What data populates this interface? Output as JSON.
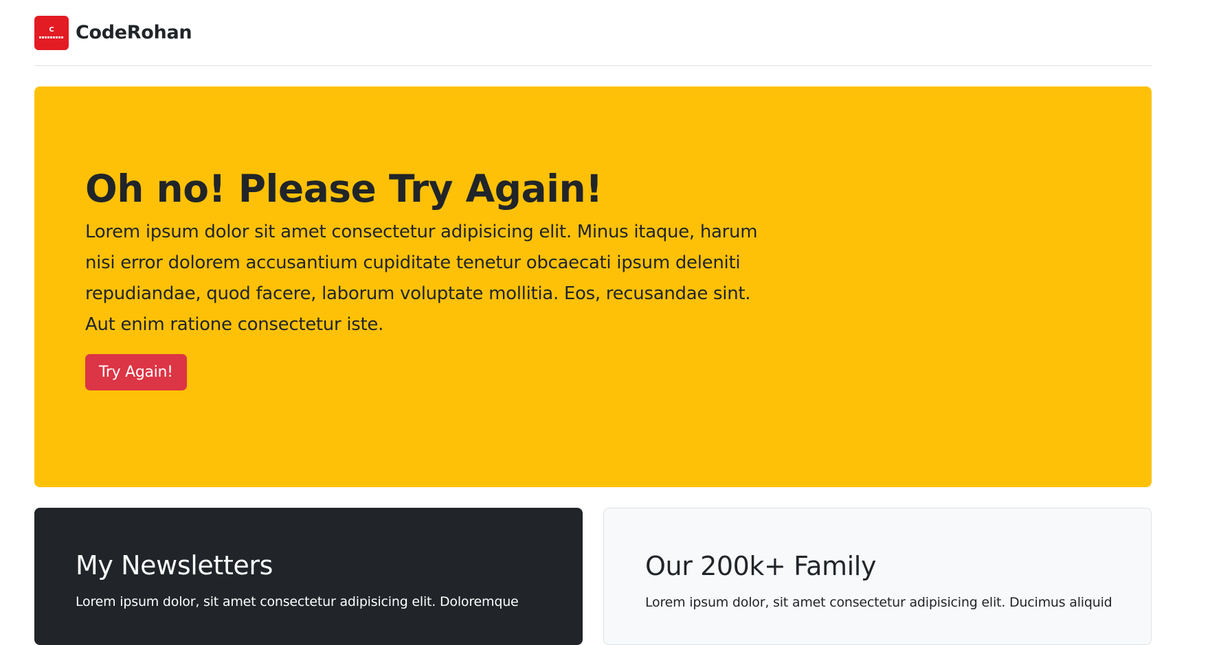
{
  "header": {
    "logo_letter": "C",
    "brand": "CodeRohan"
  },
  "hero": {
    "title": "Oh no! Please Try Again!",
    "body": "Lorem ipsum dolor sit amet consectetur adipisicing elit. Minus itaque, harum nisi error dolorem accusantium cupiditate tenetur obcaecati ipsum deleniti repudiandae, quod facere, laborum voluptate mollitia. Eos, recusandae sint. Aut enim ratione consectetur iste.",
    "button_label": "Try Again!"
  },
  "cards": [
    {
      "title": "My Newsletters",
      "text": "Lorem ipsum dolor, sit amet consectetur adipisicing elit. Doloremque"
    },
    {
      "title": "Our 200k+ Family",
      "text": "Lorem ipsum dolor, sit amet consectetur adipisicing elit. Ducimus aliquid"
    }
  ],
  "colors": {
    "hero_bg": "#ffc107",
    "button_bg": "#dc3545",
    "logo_bg": "#e31b23",
    "dark_card_bg": "#212529",
    "light_card_bg": "#f8f9fa"
  }
}
